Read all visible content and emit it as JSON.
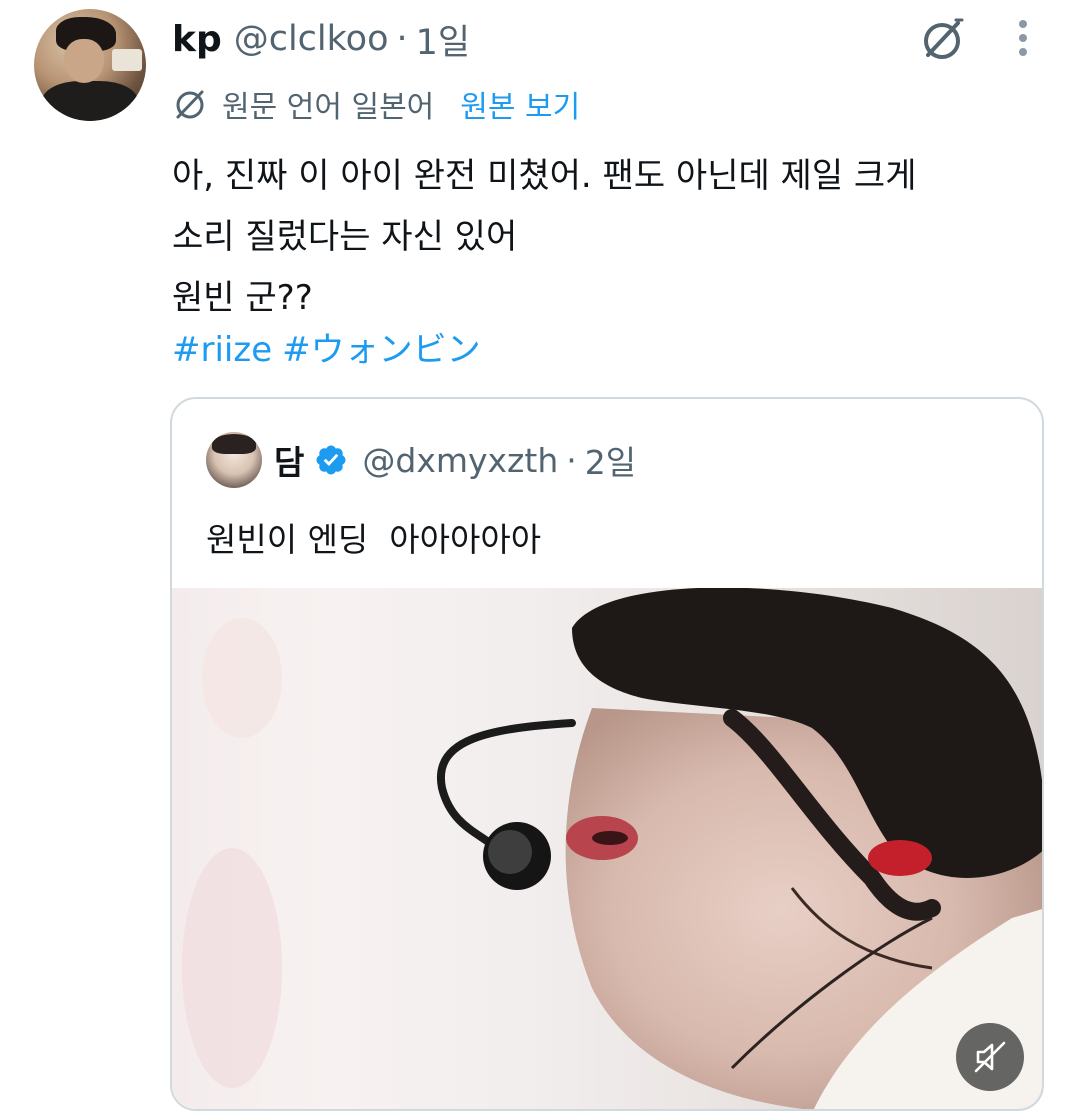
{
  "tweet": {
    "author": {
      "display_name": "kp",
      "handle": "@clclkoo",
      "time": "1일",
      "avatar_icon": "profile-avatar"
    },
    "separator": "·",
    "translation": {
      "label": "원문 언어 일본어",
      "link": "원본 보기"
    },
    "text_lines": [
      "아, 진짜 이 아이 완전 미쳤어. 팬도 아닌데 제일 크게",
      "소리 질렀다는 자신 있어",
      "원빈 군??"
    ],
    "hashtags": [
      "#riize",
      "#ウォンビン"
    ],
    "icons": {
      "grok": "grok-icon",
      "more": "more-vertical-icon",
      "translate": "translate-icon"
    }
  },
  "quoted_tweet": {
    "author": {
      "display_name": "담",
      "handle": "@dxmyxzth",
      "time": "2일",
      "verified": true
    },
    "separator": "·",
    "text": "원빈이 엔딩  아아아아아",
    "media": {
      "type": "video",
      "mute_icon": "volume-muted-icon"
    }
  },
  "colors": {
    "text_primary": "#0f1419",
    "text_secondary": "#536471",
    "link": "#1d9bf0",
    "verified": "#1d9bf0",
    "border": "#cfd9de"
  }
}
